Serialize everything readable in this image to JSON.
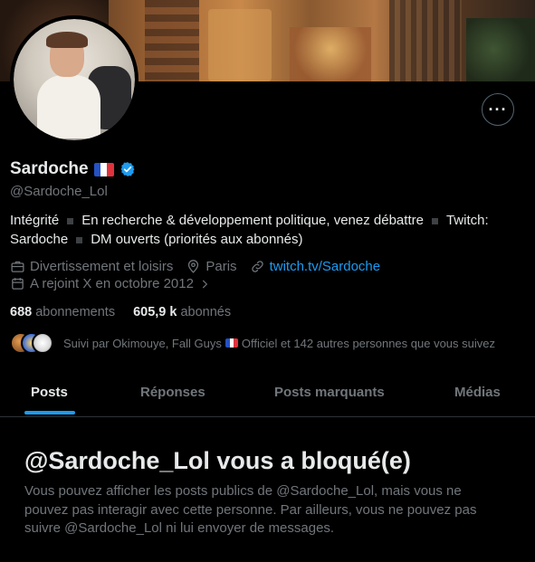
{
  "profile": {
    "name": "Sardoche",
    "handle": "@Sardoche_Lol",
    "bio": {
      "part1": "Intégrité",
      "part2": "En recherche & développement politique, venez débattre",
      "part3": "Twitch:",
      "part4": "Sardoche",
      "part5": "DM ouverts (priorités aux abonnés)"
    },
    "category": "Divertissement et loisirs",
    "location": "Paris",
    "website": "twitch.tv/Sardoche",
    "joined": "A rejoint X en octobre 2012",
    "following_count": "688",
    "following_label": "abonnements",
    "followers_count": "605,9 k",
    "followers_label": "abonnés",
    "followed_by_1": "Suivi par Okimouye, Fall Guys",
    "followed_by_2": "Officiel et 142 autres personnes que vous suivez"
  },
  "tabs": {
    "posts": "Posts",
    "replies": "Réponses",
    "highlights": "Posts marquants",
    "media": "Médias"
  },
  "blocked": {
    "title": "@Sardoche_Lol vous a bloqué(e)",
    "description": "Vous pouvez afficher les posts publics de @Sardoche_Lol, mais vous ne pouvez pas interagir avec cette personne. Par ailleurs, vous ne pouvez pas suivre @Sardoche_Lol ni lui envoyer de messages."
  },
  "colors": {
    "accent": "#1d9bf0",
    "muted": "#71767b",
    "text": "#e7e9ea",
    "background": "#000000"
  },
  "icons": {
    "more": "more-options-icon",
    "verified": "verified-badge-icon",
    "category": "briefcase-icon",
    "location": "location-pin-icon",
    "link": "link-icon",
    "joined": "calendar-icon",
    "joined_chevron": "chevron-right-icon",
    "flag": "france-flag-icon"
  }
}
